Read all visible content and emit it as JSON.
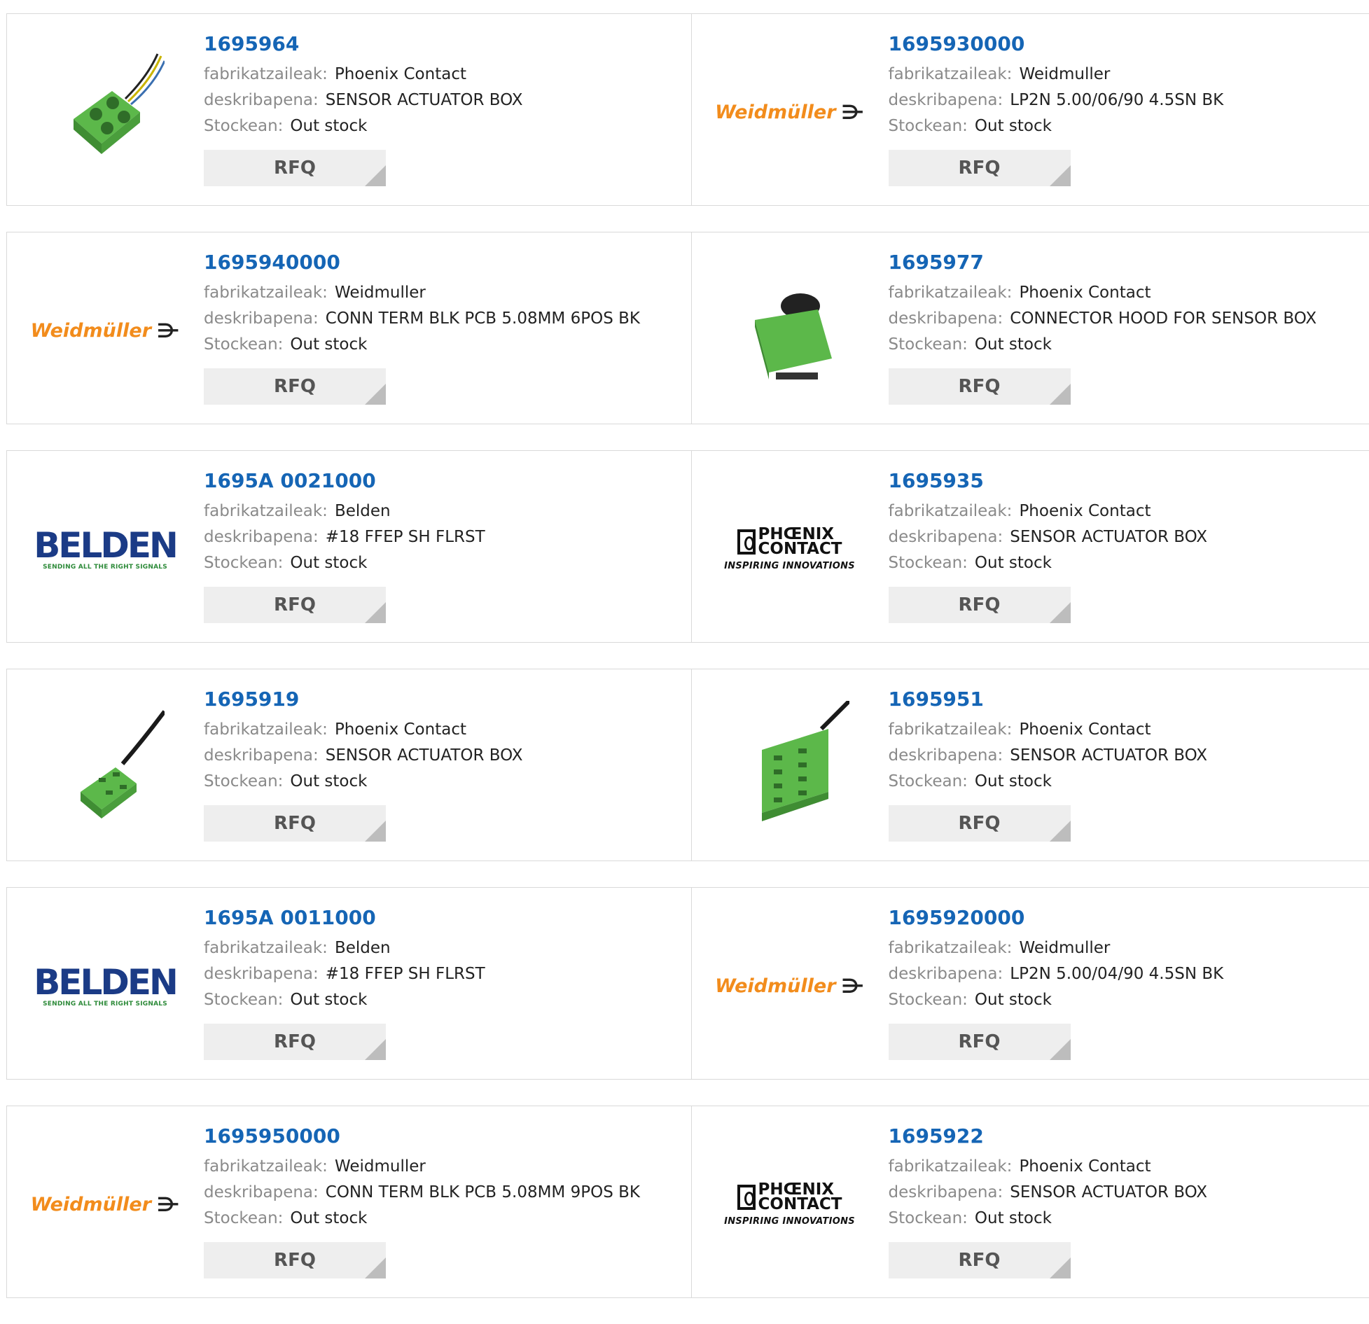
{
  "labels": {
    "manufacturer": "fabrikatzaileak:",
    "description": "deskribapena:",
    "stock": "Stockean:",
    "rfq": "RFQ"
  },
  "logos": {
    "weidmuller": {
      "text": "Weidmüller",
      "mark": "⋺"
    },
    "belden": {
      "text": "BELDEN",
      "tagline": "SENDING ALL THE RIGHT SIGNALS"
    },
    "phoenix": {
      "line1": "PHŒNIX",
      "line2": "CONTACT",
      "tagline": "INSPIRING INNOVATIONS"
    }
  },
  "colors": {
    "part_link": "#1565b5",
    "label": "#8a8a8a",
    "product_green": "#5cb84a",
    "weidmuller_orange": "#f28c1c",
    "belden_blue": "#1b3b86",
    "rfq_bg": "#eeeeee"
  },
  "rows": [
    [
      {
        "part": "1695964",
        "manufacturer": "Phoenix Contact",
        "description": "SENSOR ACTUATOR BOX",
        "stock": "Out stock",
        "image": "box-4-yellow-cable"
      },
      {
        "part": "1695930000",
        "manufacturer": "Weidmuller",
        "description": "LP2N 5.00/06/90 4.5SN BK",
        "stock": "Out stock",
        "image": "weidmuller-logo"
      }
    ],
    [
      {
        "part": "1695940000",
        "manufacturer": "Weidmuller",
        "description": "CONN TERM BLK PCB 5.08MM 6POS BK",
        "stock": "Out stock",
        "image": "weidmuller-logo"
      },
      {
        "part": "1695977",
        "manufacturer": "Phoenix Contact",
        "description": "CONNECTOR HOOD FOR SENSOR BOX",
        "stock": "Out stock",
        "image": "hood"
      }
    ],
    [
      {
        "part": "1695A 0021000",
        "manufacturer": "Belden",
        "description": "#18 FFEP SH FLRST",
        "stock": "Out stock",
        "image": "belden-logo"
      },
      {
        "part": "1695935",
        "manufacturer": "Phoenix Contact",
        "description": "SENSOR ACTUATOR BOX",
        "stock": "Out stock",
        "image": "phoenix-logo"
      }
    ],
    [
      {
        "part": "1695919",
        "manufacturer": "Phoenix Contact",
        "description": "SENSOR ACTUATOR BOX",
        "stock": "Out stock",
        "image": "box-4-black-cable"
      },
      {
        "part": "1695951",
        "manufacturer": "Phoenix Contact",
        "description": "SENSOR ACTUATOR BOX",
        "stock": "Out stock",
        "image": "box-8-black-cable"
      }
    ],
    [
      {
        "part": "1695A 0011000",
        "manufacturer": "Belden",
        "description": "#18 FFEP SH FLRST",
        "stock": "Out stock",
        "image": "belden-logo"
      },
      {
        "part": "1695920000",
        "manufacturer": "Weidmuller",
        "description": "LP2N 5.00/04/90 4.5SN BK",
        "stock": "Out stock",
        "image": "weidmuller-logo"
      }
    ],
    [
      {
        "part": "1695950000",
        "manufacturer": "Weidmuller",
        "description": "CONN TERM BLK PCB 5.08MM 9POS BK",
        "stock": "Out stock",
        "image": "weidmuller-logo"
      },
      {
        "part": "1695922",
        "manufacturer": "Phoenix Contact",
        "description": "SENSOR ACTUATOR BOX",
        "stock": "Out stock",
        "image": "phoenix-logo"
      }
    ]
  ]
}
